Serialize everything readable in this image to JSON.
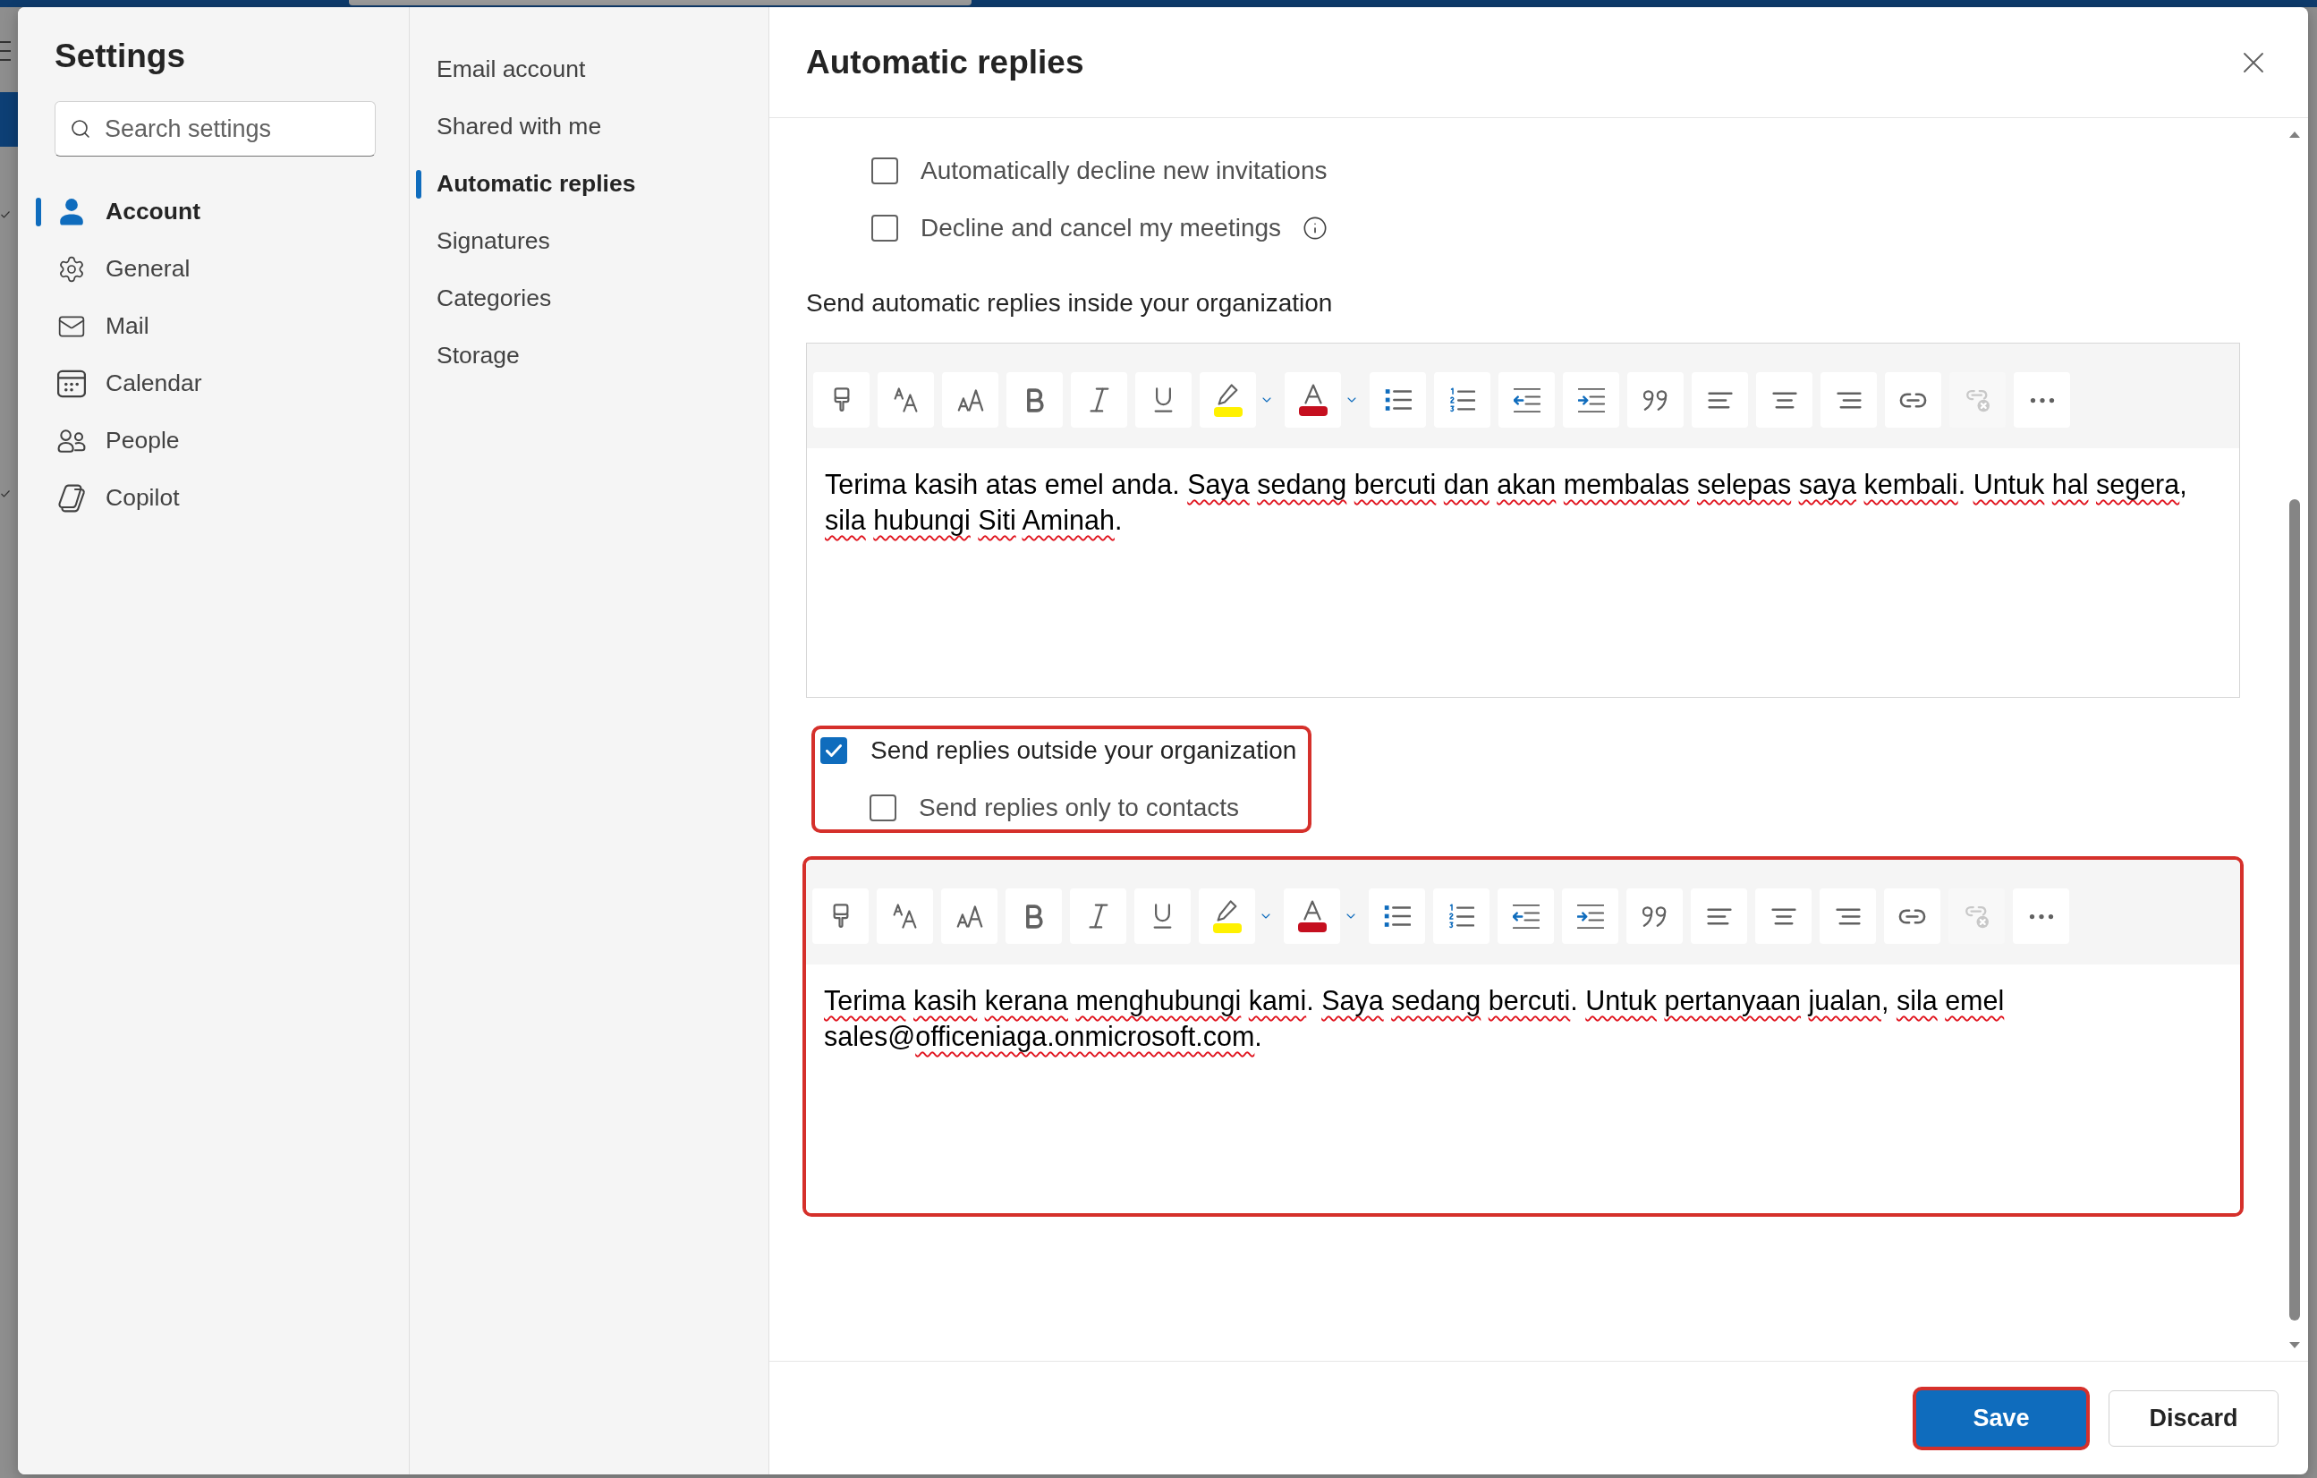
{
  "sidebar": {
    "title": "Settings",
    "search": {
      "placeholder": "Search settings"
    },
    "items": [
      {
        "label": "Account",
        "kind": "person",
        "selected": true
      },
      {
        "label": "General",
        "kind": "gear",
        "selected": false
      },
      {
        "label": "Mail",
        "kind": "envelope",
        "selected": false
      },
      {
        "label": "Calendar",
        "kind": "calendar",
        "selected": false
      },
      {
        "label": "People",
        "kind": "people",
        "selected": false
      },
      {
        "label": "Copilot",
        "kind": "copilot",
        "selected": false
      }
    ]
  },
  "subnav": {
    "items": [
      {
        "label": "Email account",
        "selected": false
      },
      {
        "label": "Shared with me",
        "selected": false
      },
      {
        "label": "Automatic replies",
        "selected": true
      },
      {
        "label": "Signatures",
        "selected": false
      },
      {
        "label": "Categories",
        "selected": false
      },
      {
        "label": "Storage",
        "selected": false
      }
    ]
  },
  "panel": {
    "title": "Automatic replies",
    "calendar_options": [
      {
        "label": "Automatically decline new invitations",
        "checked": false,
        "info": false
      },
      {
        "label": "Decline and cancel my meetings",
        "checked": false,
        "info": true
      }
    ],
    "internal": {
      "label": "Send automatic replies inside your organization",
      "editor": {
        "highlighted": false,
        "toolbar": [
          {
            "kind": "format_painter",
            "disabled": false
          },
          {
            "kind": "font",
            "disabled": false
          },
          {
            "kind": "font_size",
            "disabled": false
          },
          {
            "kind": "bold",
            "disabled": false
          },
          {
            "kind": "italic",
            "disabled": false
          },
          {
            "kind": "underline",
            "disabled": false
          },
          {
            "kind": "highlight",
            "disabled": false,
            "color": "#fff100"
          },
          {
            "kind": "font_color",
            "disabled": false,
            "color": "#c50f1f"
          },
          {
            "kind": "bullets",
            "disabled": false
          },
          {
            "kind": "numbering",
            "disabled": false
          },
          {
            "kind": "outdent",
            "disabled": false
          },
          {
            "kind": "indent",
            "disabled": false
          },
          {
            "kind": "quote",
            "disabled": false
          },
          {
            "kind": "align_left",
            "disabled": false
          },
          {
            "kind": "align_center",
            "disabled": false
          },
          {
            "kind": "align_right",
            "disabled": false
          },
          {
            "kind": "link",
            "disabled": false
          },
          {
            "kind": "unlink",
            "disabled": true
          },
          {
            "kind": "more",
            "disabled": false
          }
        ],
        "message": [
          {
            "text": "Terima kasih atas emel anda.",
            "misspelled": false
          },
          {
            "text": " Saya",
            "misspelled": true
          },
          {
            "text": " sedang",
            "misspelled": true
          },
          {
            "text": " bercuti",
            "misspelled": true
          },
          {
            "text": " dan",
            "misspelled": true
          },
          {
            "text": " akan",
            "misspelled": true
          },
          {
            "text": " membalas",
            "misspelled": true
          },
          {
            "text": " selepas",
            "misspelled": true
          },
          {
            "text": " saya",
            "misspelled": true
          },
          {
            "text": " kembali.",
            "misspelled": true
          },
          {
            "text": " Untuk",
            "misspelled": true
          },
          {
            "text": " hal",
            "misspelled": true
          },
          {
            "text": " segera,",
            "misspelled": true
          },
          {
            "text": " sila",
            "misspelled": true
          },
          {
            "text": " hubungi",
            "misspelled": true
          },
          {
            "text": " Siti",
            "misspelled": true
          },
          {
            "text": " Aminah.",
            "misspelled": true
          }
        ]
      }
    },
    "external": {
      "option": {
        "label": "Send replies outside your organization",
        "checked": true,
        "highlighted": true,
        "children": [
          {
            "label": "Send replies only to contacts",
            "checked": false
          }
        ]
      },
      "editor": {
        "highlighted": true,
        "toolbar": [
          {
            "kind": "format_painter",
            "disabled": false
          },
          {
            "kind": "font",
            "disabled": false
          },
          {
            "kind": "font_size",
            "disabled": false
          },
          {
            "kind": "bold",
            "disabled": false
          },
          {
            "kind": "italic",
            "disabled": false
          },
          {
            "kind": "underline",
            "disabled": false
          },
          {
            "kind": "highlight",
            "disabled": false,
            "color": "#fff100"
          },
          {
            "kind": "font_color",
            "disabled": false,
            "color": "#c50f1f"
          },
          {
            "kind": "bullets",
            "disabled": false
          },
          {
            "kind": "numbering",
            "disabled": false
          },
          {
            "kind": "outdent",
            "disabled": false
          },
          {
            "kind": "indent",
            "disabled": false
          },
          {
            "kind": "quote",
            "disabled": false
          },
          {
            "kind": "align_left",
            "disabled": false
          },
          {
            "kind": "align_center",
            "disabled": false
          },
          {
            "kind": "align_right",
            "disabled": false
          },
          {
            "kind": "link",
            "disabled": false
          },
          {
            "kind": "unlink",
            "disabled": true
          },
          {
            "kind": "more",
            "disabled": false
          }
        ],
        "message": [
          {
            "text": "Terima",
            "misspelled": true
          },
          {
            "text": " kasih",
            "misspelled": true
          },
          {
            "text": " kerana",
            "misspelled": true
          },
          {
            "text": " menghubungi",
            "misspelled": true
          },
          {
            "text": " kami.",
            "misspelled": true
          },
          {
            "text": " Saya",
            "misspelled": true
          },
          {
            "text": " sedang",
            "misspelled": true
          },
          {
            "text": " bercuti.",
            "misspelled": true
          },
          {
            "text": " Untuk",
            "misspelled": true
          },
          {
            "text": " pertanyaan",
            "misspelled": true
          },
          {
            "text": " jualan,",
            "misspelled": true
          },
          {
            "text": " sila",
            "misspelled": true
          },
          {
            "text": " emel",
            "misspelled": true
          },
          {
            "text": " sales@",
            "misspelled": false
          },
          {
            "text": "officeniaga.onmicrosoft.com.",
            "misspelled": true
          }
        ]
      }
    },
    "buttons": [
      {
        "label": "Save",
        "kind": "primary",
        "highlighted": true
      },
      {
        "label": "Discard",
        "kind": "secondary",
        "highlighted": false
      }
    ]
  }
}
